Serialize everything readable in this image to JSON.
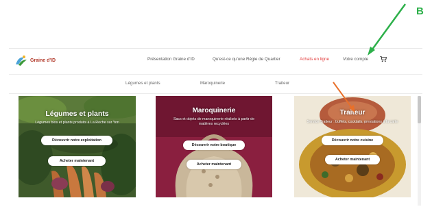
{
  "header": {
    "logo_text": "Graine d'ID",
    "nav": [
      "Présentation Graine d'ID",
      "Qu'est-ce qu'une Régie de Quartier",
      "Achats en ligne",
      "Votre compte"
    ]
  },
  "subnav": [
    "Légumes et plants",
    "Maroquinerie",
    "Traiteur"
  ],
  "cards": [
    {
      "title": "Légumes et plants",
      "desc": "Légumes bios et plants produits à La Roche sur Yon",
      "btn1": "Découvrir notre exploitation",
      "btn2": "Acheter maintenant"
    },
    {
      "title": "Maroquinerie",
      "desc": "Sacs et objets de maroquinerie réalisés à partir de matières recyclées",
      "btn1": "Découvrir notre boutique",
      "btn2": "Acheter maintenant"
    },
    {
      "title": "Traiteur",
      "desc": "Service Traiteur : buffets, cocktails, prestations à la carte",
      "btn1": "Découvrir notre cuisine",
      "btn2": "Acheter maintenant"
    }
  ],
  "annotation": {
    "label": "B"
  },
  "colors": {
    "accent": "#e23a3a",
    "annotation_green": "#2db04a",
    "annotation_orange": "#e8702a"
  }
}
